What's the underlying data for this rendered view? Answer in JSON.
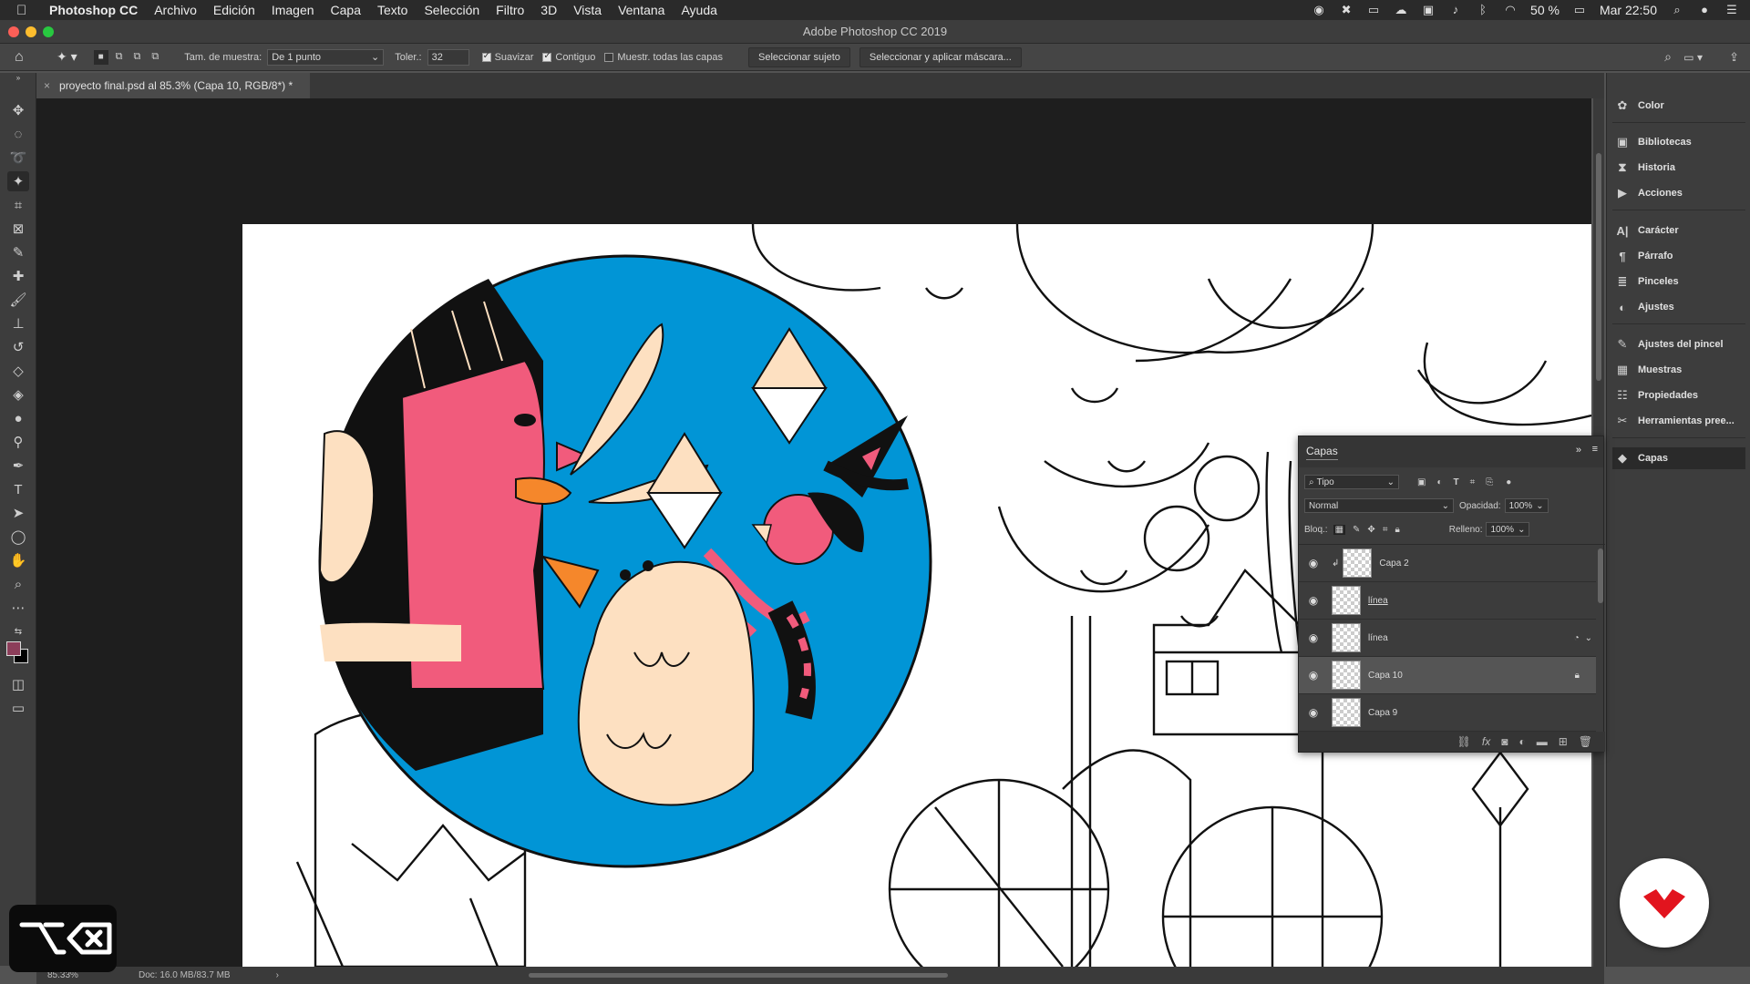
{
  "menubar": {
    "app_name": "Photoshop CC",
    "items": [
      "Archivo",
      "Edición",
      "Imagen",
      "Capa",
      "Texto",
      "Selección",
      "Filtro",
      "3D",
      "Vista",
      "Ventana",
      "Ayuda"
    ],
    "battery": "50 %",
    "clock": "Mar 22:50"
  },
  "window": {
    "title": "Adobe Photoshop CC 2019"
  },
  "options": {
    "sample_size_label": "Tam. de muestra:",
    "sample_size_value": "De 1 punto",
    "tolerance_label": "Toler.:",
    "tolerance_value": "32",
    "antialias_label": "Suavizar",
    "contiguous_label": "Contiguo",
    "sample_all_label": "Muestr. todas las capas",
    "select_subject_label": "Seleccionar sujeto",
    "select_mask_label": "Seleccionar y aplicar máscara..."
  },
  "document": {
    "tab_title": "proyecto final.psd al 85.3% (Capa 10, RGB/8*) *"
  },
  "status": {
    "zoom": "85.33%",
    "doc_size": "Doc: 16.0 MB/83.7 MB"
  },
  "dock": {
    "color": "Color",
    "libraries": "Bibliotecas",
    "history": "Historia",
    "actions": "Acciones",
    "character": "Carácter",
    "paragraph": "Párrafo",
    "brushes": "Pinceles",
    "adjustments": "Ajustes",
    "brush_settings": "Ajustes del pincel",
    "swatches": "Muestras",
    "properties": "Propiedades",
    "presets": "Herramientas pree...",
    "layers": "Capas"
  },
  "layers_panel": {
    "title": "Capas",
    "filter_kind": "Tipo",
    "blend_mode": "Normal",
    "opacity_label": "Opacidad:",
    "opacity_value": "100%",
    "lock_label": "Bloq.:",
    "fill_label": "Relleno:",
    "fill_value": "100%",
    "layers": [
      {
        "name": "Capa 2"
      },
      {
        "name": "línea"
      },
      {
        "name": "línea"
      },
      {
        "name": "Capa 10"
      },
      {
        "name": "Capa 9"
      }
    ]
  },
  "colors": {
    "accent_blue": "#0195d6",
    "pink": "#f15b7c",
    "peach": "#fde0c1",
    "orange": "#f5872b",
    "brand_red": "#e2141e"
  }
}
